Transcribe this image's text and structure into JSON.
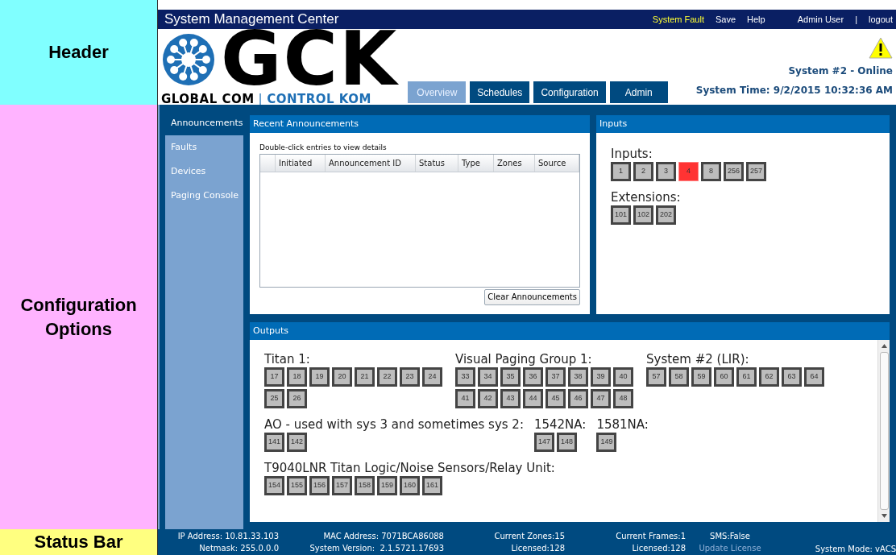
{
  "annotations": [
    {
      "label": "Header",
      "kind": "header",
      "color": "#80ffff"
    },
    {
      "label": "Configuration Options",
      "kind": "body",
      "color": "#ffb3ff"
    },
    {
      "label": "Status Bar",
      "kind": "footer",
      "color": "#ffff80"
    }
  ],
  "header": {
    "title": "System Management Center",
    "links": [
      {
        "label": "System Fault",
        "kind": "alert"
      },
      {
        "label": "Save",
        "kind": "link"
      },
      {
        "label": "Help",
        "kind": "link"
      },
      {
        "label": "Admin User",
        "kind": "user"
      },
      {
        "label": "|",
        "kind": "separator"
      },
      {
        "label": "logout",
        "kind": "link"
      }
    ],
    "logo": {
      "mark": "GCK",
      "left": "GLOBAL COM",
      "separator": "|",
      "right": "CONTROL KOM"
    },
    "tabs": [
      {
        "label": "Overview",
        "selected": true
      },
      {
        "label": "Schedules",
        "selected": false
      },
      {
        "label": "Configuration",
        "selected": false
      },
      {
        "label": "Admin",
        "selected": false
      }
    ],
    "system_status": "System #2 - Online",
    "system_time": "System Time: 9/2/2015 10:32:36 AM"
  },
  "sidebar": {
    "items": [
      {
        "label": "Announcements",
        "selected": true
      },
      {
        "label": "Faults",
        "selected": false
      },
      {
        "label": "Devices",
        "selected": false
      },
      {
        "label": "Paging Console",
        "selected": false
      }
    ]
  },
  "recent_announcements": {
    "title": "Recent Announcements",
    "hint": "Double-click entries to view details",
    "columns": [
      "Initiated",
      "Announcement ID",
      "Status",
      "Type",
      "Zones",
      "Source"
    ],
    "clear_button": "Clear Announcements"
  },
  "inputs": {
    "title": "Inputs",
    "groups": [
      {
        "label": "Inputs:",
        "tiles": [
          {
            "label": "1",
            "fault": false
          },
          {
            "label": "2",
            "fault": false
          },
          {
            "label": "3",
            "fault": false
          },
          {
            "label": "4",
            "fault": true
          },
          {
            "label": "8",
            "fault": false
          },
          {
            "label": "256",
            "fault": false
          },
          {
            "label": "257",
            "fault": false
          }
        ]
      },
      {
        "label": "Extensions:",
        "tiles": [
          {
            "label": "101",
            "fault": false
          },
          {
            "label": "102",
            "fault": false
          },
          {
            "label": "202",
            "fault": false
          }
        ]
      }
    ]
  },
  "outputs": {
    "title": "Outputs",
    "rows": [
      [
        {
          "label": "Titan 1:",
          "tiles": [
            {
              "label": "17",
              "fault": false
            },
            {
              "label": "18",
              "fault": false
            },
            {
              "label": "19",
              "fault": false
            },
            {
              "label": "20",
              "fault": false
            },
            {
              "label": "21",
              "fault": false
            },
            {
              "label": "22",
              "fault": false
            },
            {
              "label": "23",
              "fault": false
            },
            {
              "label": "24",
              "fault": false
            },
            {
              "label": "25",
              "fault": false
            },
            {
              "label": "26",
              "fault": false
            }
          ]
        },
        {
          "label": "Visual Paging Group 1:",
          "tiles": [
            {
              "label": "33",
              "fault": false
            },
            {
              "label": "34",
              "fault": false
            },
            {
              "label": "35",
              "fault": false
            },
            {
              "label": "36",
              "fault": false
            },
            {
              "label": "37",
              "fault": false
            },
            {
              "label": "38",
              "fault": false
            },
            {
              "label": "39",
              "fault": false
            },
            {
              "label": "40",
              "fault": false
            },
            {
              "label": "41",
              "fault": false
            },
            {
              "label": "42",
              "fault": false
            },
            {
              "label": "43",
              "fault": false
            },
            {
              "label": "44",
              "fault": false
            },
            {
              "label": "45",
              "fault": false
            },
            {
              "label": "46",
              "fault": false
            },
            {
              "label": "47",
              "fault": false
            },
            {
              "label": "48",
              "fault": false
            }
          ]
        },
        {
          "label": "System #2 (LIR):",
          "tiles": [
            {
              "label": "57",
              "fault": false
            },
            {
              "label": "58",
              "fault": false
            },
            {
              "label": "59",
              "fault": false
            },
            {
              "label": "60",
              "fault": false
            },
            {
              "label": "61",
              "fault": false
            },
            {
              "label": "62",
              "fault": false
            },
            {
              "label": "63",
              "fault": false
            },
            {
              "label": "64",
              "fault": false
            }
          ]
        }
      ],
      [
        {
          "label": "AO - used with sys 3 and sometimes sys 2:",
          "tiles": [
            {
              "label": "141",
              "fault": false
            },
            {
              "label": "142",
              "fault": false
            }
          ]
        },
        {
          "label": "1542NA:",
          "tiles": [
            {
              "label": "147",
              "fault": false
            },
            {
              "label": "148",
              "fault": false
            }
          ]
        },
        {
          "label": "1581NA:",
          "tiles": [
            {
              "label": "149",
              "fault": false
            }
          ]
        }
      ],
      [
        {
          "label": "T9040LNR Titan Logic/Noise Sensors/Relay Unit:",
          "tiles": [
            {
              "label": "154",
              "fault": false
            },
            {
              "label": "155",
              "fault": false
            },
            {
              "label": "156",
              "fault": false
            },
            {
              "label": "157",
              "fault": false
            },
            {
              "label": "158",
              "fault": false
            },
            {
              "label": "159",
              "fault": false
            },
            {
              "label": "160",
              "fault": false
            },
            {
              "label": "161",
              "fault": false
            }
          ]
        }
      ]
    ]
  },
  "status_bar": {
    "columns": [
      {
        "lines": [
          {
            "text": "IP Address: 10.81.33.103",
            "kind": "text"
          },
          {
            "text": "Netmask: 255.0.0.0",
            "kind": "text"
          }
        ]
      },
      {
        "lines": [
          {
            "text": "MAC Address: 7071BCA86088",
            "kind": "text"
          },
          {
            "text": "System Version:  2.1.5721.17693",
            "kind": "text"
          }
        ]
      },
      {
        "lines": [
          {
            "text": "Current Zones:15",
            "kind": "text"
          },
          {
            "text": "Licensed:128",
            "kind": "text"
          }
        ]
      },
      {
        "lines": [
          {
            "text": "Current Frames:1",
            "kind": "text"
          },
          {
            "text": "Licensed:128",
            "kind": "text"
          }
        ]
      },
      {
        "lines": [
          {
            "text": "SMS:False",
            "kind": "text"
          },
          {
            "text": "Update License",
            "kind": "link"
          }
        ]
      },
      {
        "lines": [
          {
            "text": "System Mode: vACS",
            "kind": "text"
          }
        ]
      }
    ]
  }
}
